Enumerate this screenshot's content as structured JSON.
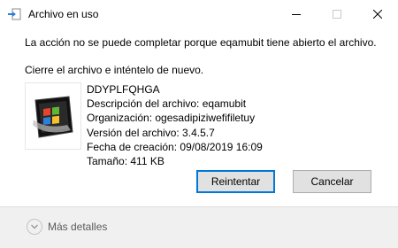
{
  "window": {
    "title": "Archivo en uso",
    "minimize_icon": "minimize-icon",
    "maximize_icon": "maximize-icon",
    "close_icon": "close-icon"
  },
  "message": {
    "line1": "La acción no se puede completar porque eqamubit tiene abierto el archivo.",
    "line2": "Cierre el archivo e inténtelo de nuevo."
  },
  "file": {
    "icon": "windows-program-icon",
    "name": "DDYPLFQHGA",
    "description": "Descripción del archivo: eqamubit",
    "organization": "Organización: ogesadipiziwefifiletuy",
    "version": "Versión del archivo: 3.4.5.7",
    "created": "Fecha de creación: 09/08/2019 16:09",
    "size": "Tamaño: 411 KB"
  },
  "buttons": {
    "retry": "Reintentar",
    "cancel": "Cancelar"
  },
  "footer": {
    "more_details": "Más detalles",
    "more_icon": "chevron-down-icon"
  },
  "colors": {
    "accent": "#0078d7",
    "footer_bg": "#f0f0f0",
    "button_bg": "#e1e1e1"
  }
}
